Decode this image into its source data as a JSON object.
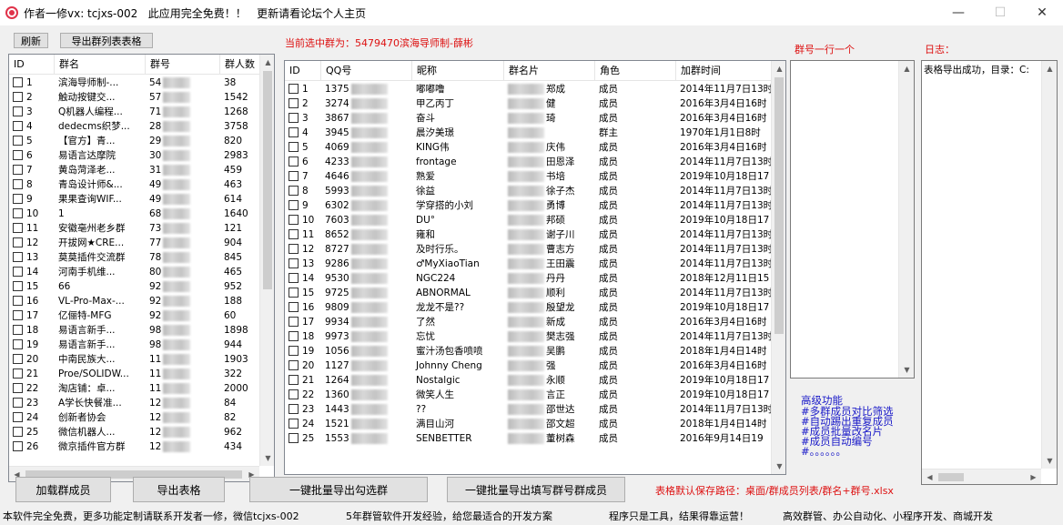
{
  "window": {
    "title": "作者一修vx: tcjxs-002   此应用完全免费！！   更新请看论坛个人主页",
    "minimize": "—",
    "maximize": "☐",
    "close": "✕"
  },
  "toolbar": {
    "refresh_label": "刷新",
    "export_group_list_label": "导出群列表表格"
  },
  "current_group_label": "当前选中群为：5479470滨海导师制-薛彬",
  "group_list": {
    "columns": [
      "ID",
      "群名",
      "群号",
      "群人数"
    ],
    "rows": [
      {
        "id": "1",
        "name": "滨海导师制-...",
        "num": "54",
        "count": "38"
      },
      {
        "id": "2",
        "name": "触动按键交...",
        "num": "57",
        "count": "1542"
      },
      {
        "id": "3",
        "name": "Q机器人编程...",
        "num": "71",
        "count": "1268"
      },
      {
        "id": "4",
        "name": "dedecms织梦...",
        "num": "28",
        "count": "3758"
      },
      {
        "id": "5",
        "name": "【官方】青...",
        "num": "29",
        "count": "820"
      },
      {
        "id": "6",
        "name": "易语言达摩院",
        "num": "30",
        "count": "2983"
      },
      {
        "id": "7",
        "name": "黄岛菏泽老...",
        "num": "31",
        "count": "459"
      },
      {
        "id": "8",
        "name": "青岛设计师&...",
        "num": "49",
        "count": "463"
      },
      {
        "id": "9",
        "name": "果果查询WIF...",
        "num": "49",
        "count": "614"
      },
      {
        "id": "10",
        "name": "1",
        "num": "68",
        "count": "1640"
      },
      {
        "id": "11",
        "name": "安徽亳州老乡群",
        "num": "73",
        "count": "121"
      },
      {
        "id": "12",
        "name": "开拔网★CRE...",
        "num": "77",
        "count": "904"
      },
      {
        "id": "13",
        "name": "莫莫插件交流群",
        "num": "78",
        "count": "845"
      },
      {
        "id": "14",
        "name": "河南手机维...",
        "num": "80",
        "count": "465"
      },
      {
        "id": "15",
        "name": "66",
        "num": "92",
        "count": "952"
      },
      {
        "id": "16",
        "name": "VL-Pro-Max-...",
        "num": "92",
        "count": "188"
      },
      {
        "id": "17",
        "name": "亿俪特-MFG",
        "num": "92",
        "count": "60"
      },
      {
        "id": "18",
        "name": "易语言新手...",
        "num": "98",
        "count": "1898"
      },
      {
        "id": "19",
        "name": "易语言新手...",
        "num": "98",
        "count": "944"
      },
      {
        "id": "20",
        "name": "中南民族大...",
        "num": "11",
        "count": "1903"
      },
      {
        "id": "21",
        "name": "Proe/SOLIDW...",
        "num": "11",
        "count": "322"
      },
      {
        "id": "22",
        "name": "淘店铺：卓...",
        "num": "11",
        "count": "2000"
      },
      {
        "id": "23",
        "name": "A学长快餐准...",
        "num": "12",
        "count": "84"
      },
      {
        "id": "24",
        "name": "创新者协会",
        "num": "12",
        "count": "82"
      },
      {
        "id": "25",
        "name": "微信机器人...",
        "num": "12",
        "count": "962"
      },
      {
        "id": "26",
        "name": "微京插件官方群",
        "num": "12",
        "count": "434"
      }
    ]
  },
  "member_list": {
    "columns": [
      "ID",
      "QQ号",
      "昵称",
      "群名片",
      "角色",
      "加群时间"
    ],
    "rows": [
      {
        "id": "1",
        "qq": "1375",
        "nick": "嘟嘟噜",
        "card": "郑成",
        "role": "成员",
        "time": "2014年11月7日13时"
      },
      {
        "id": "2",
        "qq": "3274",
        "nick": "甲乙丙丁",
        "card": "健",
        "role": "成员",
        "time": "2016年3月4日16时"
      },
      {
        "id": "3",
        "qq": "3867",
        "nick": "奋斗",
        "card": "琦",
        "role": "成员",
        "time": "2016年3月4日16时"
      },
      {
        "id": "4",
        "qq": "3945",
        "nick": "晨汐美璟",
        "card": "",
        "role": "群主",
        "time": "1970年1月1日8时"
      },
      {
        "id": "5",
        "qq": "4069",
        "nick": "KING伟",
        "card": "庆伟",
        "role": "成员",
        "time": "2016年3月4日16时"
      },
      {
        "id": "6",
        "qq": "4233",
        "nick": "frontage",
        "card": "田恩泽",
        "role": "成员",
        "time": "2014年11月7日13时"
      },
      {
        "id": "7",
        "qq": "4646",
        "nick": "熟爱",
        "card": "书培",
        "role": "成员",
        "time": "2019年10月18日17"
      },
      {
        "id": "8",
        "qq": "5993",
        "nick": "徐益",
        "card": "徐子杰",
        "role": "成员",
        "time": "2014年11月7日13时"
      },
      {
        "id": "9",
        "qq": "6302",
        "nick": "学穿搭的小刘",
        "card": "勇博",
        "role": "成员",
        "time": "2014年11月7日13时"
      },
      {
        "id": "10",
        "qq": "7603",
        "nick": "DU°",
        "card": "邦硕",
        "role": "成员",
        "time": "2019年10月18日17"
      },
      {
        "id": "11",
        "qq": "8652",
        "nick": "雍和",
        "card": "谢子川",
        "role": "成员",
        "time": "2014年11月7日13时"
      },
      {
        "id": "12",
        "qq": "8727",
        "nick": "及时行乐。",
        "card": "曹志方",
        "role": "成员",
        "time": "2014年11月7日13时"
      },
      {
        "id": "13",
        "qq": "9286",
        "nick": "♂MyXiaoTian",
        "card": "王田震",
        "role": "成员",
        "time": "2014年11月7日13时"
      },
      {
        "id": "14",
        "qq": "9530",
        "nick": "NGC224",
        "card": "丹丹",
        "role": "成员",
        "time": "2018年12月11日15"
      },
      {
        "id": "15",
        "qq": "9725",
        "nick": "ABNORMAL",
        "card": "顺利",
        "role": "成员",
        "time": "2014年11月7日13时"
      },
      {
        "id": "16",
        "qq": "9809",
        "nick": "龙龙不是??",
        "card": "殷望龙",
        "role": "成员",
        "time": "2019年10月18日17"
      },
      {
        "id": "17",
        "qq": "9934",
        "nick": "了然",
        "card": "新成",
        "role": "成员",
        "time": "2016年3月4日16时"
      },
      {
        "id": "18",
        "qq": "9973",
        "nick": "忘忧",
        "card": "樊志强",
        "role": "成员",
        "time": "2014年11月7日13时"
      },
      {
        "id": "19",
        "qq": "1056",
        "nick": "蜜汁汤包香喷喷",
        "card": "吴鹏",
        "role": "成员",
        "time": "2018年1月4日14时"
      },
      {
        "id": "20",
        "qq": "1127",
        "nick": "Johnny Cheng",
        "card": "强",
        "role": "成员",
        "time": "2016年3月4日16时"
      },
      {
        "id": "21",
        "qq": "1264",
        "nick": "Nostalgic",
        "card": "永顺",
        "role": "成员",
        "time": "2019年10月18日17"
      },
      {
        "id": "22",
        "qq": "1360",
        "nick": "微笑人生",
        "card": "言正",
        "role": "成员",
        "time": "2019年10月18日17"
      },
      {
        "id": "23",
        "qq": "1443",
        "nick": "??",
        "card": "邵世达",
        "role": "成员",
        "time": "2014年11月7日13时"
      },
      {
        "id": "24",
        "qq": "1521",
        "nick": "满目山河",
        "card": "邵文超",
        "role": "成员",
        "time": "2018年1月4日14时"
      },
      {
        "id": "25",
        "qq": "1553",
        "nick": "SENBETTER",
        "card": "董树森",
        "role": "成员",
        "time": "2016年9月14日19"
      }
    ]
  },
  "group_input": {
    "label": "群号一行一个"
  },
  "log": {
    "label": "日志：",
    "text": "表格导出成功，目录：C:"
  },
  "advanced": {
    "title": "高级功能",
    "lines": [
      "#多群成员对比筛选",
      "#自动踢出重复成员",
      "#成员批量改名片",
      "#成员自动编号",
      "#。。。。。。"
    ]
  },
  "buttons": {
    "load_members": "加载群成员",
    "export_table": "导出表格",
    "batch_export_checked": "一键批量导出勾选群",
    "batch_export_filled": "一键批量导出填写群号群成员"
  },
  "save_path": "表格默认保存路径：桌面/群成员列表/群名+群号.xlsx",
  "status": {
    "seg1": "本软件完全免费，更多功能定制请联系开发者一修，微信tcjxs-002",
    "seg2": "5年群管软件开发经验，给您最适合的开发方案",
    "seg3": "程序只是工具，结果得靠运营！",
    "seg4": "高效群管、办公自动化、小程序开发、商城开发"
  }
}
